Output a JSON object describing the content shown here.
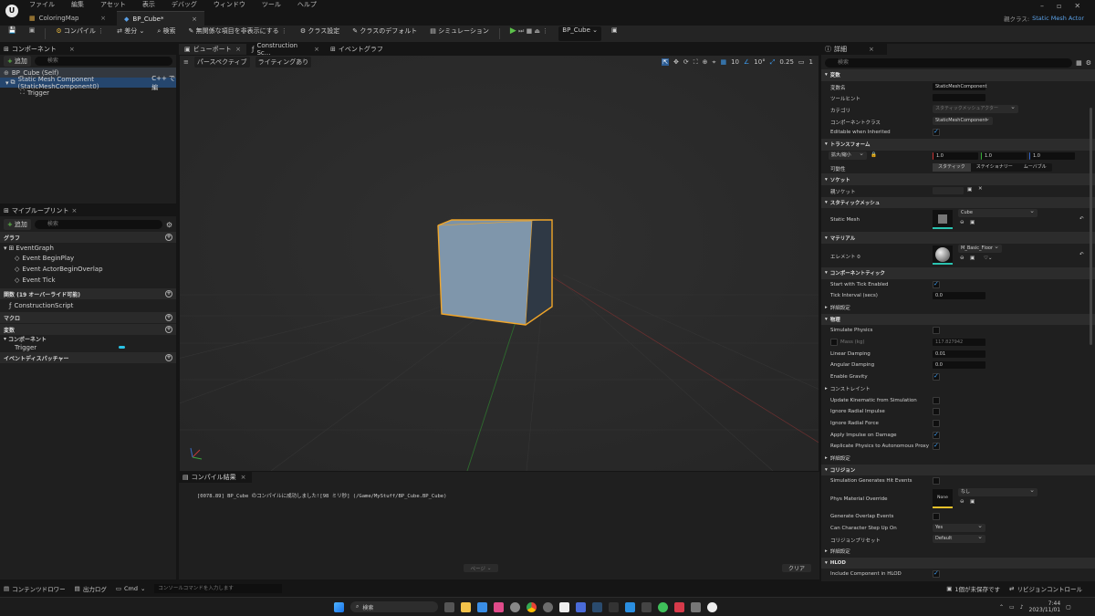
{
  "menu": [
    "ファイル",
    "編集",
    "アセット",
    "表示",
    "デバッグ",
    "ウィンドウ",
    "ツール",
    "ヘルプ"
  ],
  "tabs": [
    {
      "label": "ColoringMap"
    },
    {
      "label": "BP_Cube*"
    }
  ],
  "parent_class": {
    "label": "親クラス:",
    "value": "Static Mesh Actor"
  },
  "toolbar": {
    "compile": "コンパイル",
    "diff": "差分",
    "search": "検索",
    "hide_unrelated": "無関係な項目を非表示にする",
    "class_settings": "クラス設定",
    "class_defaults": "クラスのデフォルト",
    "simulation": "シミュレーション",
    "debug_object": "BP_Cube"
  },
  "components_panel": {
    "title": "コンポーネント",
    "add": "追加",
    "search_placeholder": "検索",
    "items": [
      {
        "label": "BP_Cube (Self)"
      },
      {
        "label": "Static Mesh Component (StaticMeshComponent0)",
        "suffix": "C++ で編"
      },
      {
        "label": "Trigger"
      }
    ]
  },
  "my_blueprint": {
    "title": "マイブループリント",
    "add": "追加",
    "search_placeholder": "検索",
    "graph_section": "グラフ",
    "event_graph": "EventGraph",
    "events": [
      "Event BeginPlay",
      "Event ActorBeginOverlap",
      "Event Tick"
    ],
    "functions_section": "関数 (19 オーバーライド可能)",
    "construction_script": "ConstructionScript",
    "macros_section": "マクロ",
    "variables_section": "変数",
    "components_label": "コンポーネント",
    "trigger_var": "Trigger",
    "dispatchers_section": "イベントディスパッチャー"
  },
  "center_tabs": [
    "ビューポート",
    "Construction Sc...",
    "イベントグラフ"
  ],
  "viewport": {
    "perspective": "パースペクティブ",
    "lighting": "ライティングあり",
    "grid_snap": "10",
    "rot_snap": "10°",
    "scale_snap": "0.25",
    "cam_speed": "1"
  },
  "compile_results": {
    "title": "コンパイル結果",
    "message": "[0078.89] BP_Cube のコンパイルに成功しました![98 ミリ秒] (/Game/MyStuff/BP_Cube.BP_Cube)",
    "page": "ページ",
    "clear": "クリア"
  },
  "details": {
    "title": "詳細",
    "search_placeholder": "検索",
    "variable": {
      "section": "変数",
      "name_label": "変数名",
      "name_value": "StaticMeshComponent",
      "tooltip_label": "ツールヒント",
      "category_label": "カテゴリ",
      "category_value": "スタティックメッシュアクター",
      "component_class_label": "コンポーネントクラス",
      "component_class_value": "StaticMeshComponent",
      "editable_label": "Editable when Inherited"
    },
    "transform": {
      "section": "トランスフォーム",
      "scale_label": "拡大/縮小",
      "scale": [
        "1.0",
        "1.0",
        "1.0"
      ],
      "mobility_label": "可動性",
      "mobility": [
        "スタティック",
        "ステイショナリー",
        "ムーバブル"
      ]
    },
    "socket": {
      "section": "ソケット",
      "parent_label": "親ソケット"
    },
    "static_mesh": {
      "section": "スタティックメッシュ",
      "label": "Static Mesh",
      "value": "Cube"
    },
    "materials": {
      "section": "マテリアル",
      "label": "エレメント 0",
      "value": "M_Basic_Floor"
    },
    "component_tick": {
      "section": "コンポーネントティック",
      "start_label": "Start with Tick Enabled",
      "interval_label": "Tick Interval (secs)",
      "interval_value": "0.0",
      "advanced": "詳細設定"
    },
    "physics": {
      "section": "物理",
      "simulate_label": "Simulate Physics",
      "mass_label": "Mass (kg)",
      "mass_value": "117.827942",
      "linear_label": "Linear Damping",
      "linear_value": "0.01",
      "angular_label": "Angular Damping",
      "angular_value": "0.0",
      "gravity_label": "Enable Gravity",
      "constraints": "コンストレイント",
      "kinematic_label": "Update Kinematic from Simulation",
      "radial_impulse_label": "Ignore Radial Impulse",
      "radial_force_label": "Ignore Radial Force",
      "apply_impulse_label": "Apply Impulse on Damage",
      "replicate_label": "Replicate Physics to Autonomous Proxy",
      "advanced": "詳細設定"
    },
    "collision": {
      "section": "コリジョン",
      "hit_label": "Simulation Generates Hit Events",
      "phys_mat_label": "Phys Material Override",
      "phys_mat_thumb": "None",
      "phys_mat_value": "なし",
      "overlap_label": "Generate Overlap Events",
      "step_label": "Can Character Step Up On",
      "step_value": "Yes",
      "preset_label": "コリジョンプリセット",
      "preset_value": "Default",
      "advanced": "詳細設定"
    },
    "hlod": {
      "section": "HLOD",
      "include_label": "Include Component in HLOD"
    }
  },
  "status_bar": {
    "content_drawer": "コンテンツドロワー",
    "output_log": "出力ログ",
    "cmd": "Cmd",
    "console_placeholder": "コンソールコマンドを入力します",
    "unsaved": "1個が未保存です",
    "revision": "リビジョンコントロール"
  },
  "taskbar": {
    "search": "検索",
    "time": "7:44",
    "date": "2023/11/01"
  }
}
